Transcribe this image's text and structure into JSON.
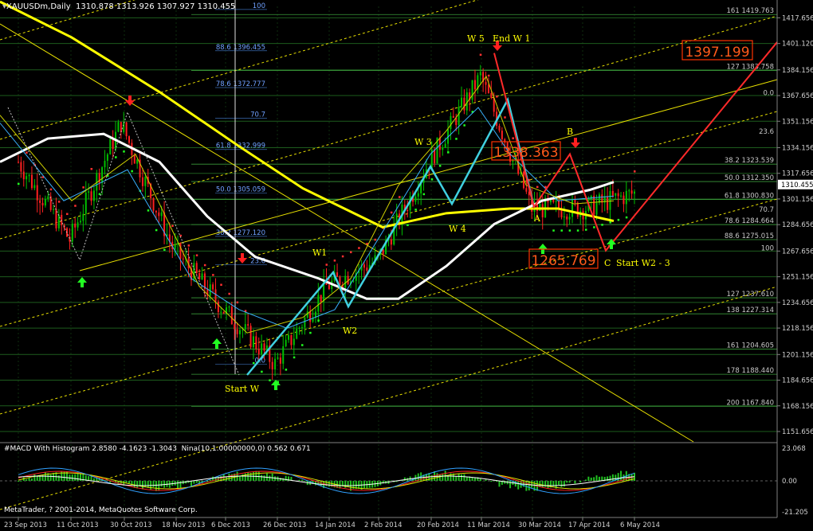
{
  "header": {
    "title": "XAUUSDm,Daily",
    "ohlc": "1310.878 1313.926 1307.927 1310.455",
    "indicator": "#MACD With Histogram 2.8580 -4.1623 -1.3043",
    "indicator2": "Nina(10,1.00000000,0) 0.562 0.671",
    "copyright": "MetaTrader, ? 2001-2014, MetaQuotes Software Corp."
  },
  "price_axis": {
    "ticks": [
      "1417.656",
      "1401.120",
      "1384.156",
      "1367.656",
      "1351.156",
      "1334.156",
      "1317.656",
      "1301.156",
      "1284.656",
      "1267.656",
      "1251.156",
      "1234.656",
      "1218.156",
      "1201.156",
      "1184.656",
      "1168.156",
      "1151.656"
    ],
    "current_price": "1310.455"
  },
  "macd_axis": {
    "ticks": [
      "23.068",
      "0.00",
      "-21.205"
    ]
  },
  "time_axis": {
    "ticks": [
      "23 Sep 2013",
      "11 Oct 2013",
      "30 Oct 2013",
      "18 Nov 2013",
      "6 Dec 2013",
      "26 Dec 2013",
      "14 Jan 2014",
      "2 Feb 2014",
      "20 Feb 2014",
      "11 Mar 2014",
      "30 Mar 2014",
      "17 Apr 2014",
      "6 May 2014"
    ]
  },
  "fib_left": [
    "100",
    "88.6  1396.455",
    "78.6  1372.777",
    "70.7",
    "61.8  1332.999",
    "50.0  1305.059",
    "38.2  1277.120",
    "23.6",
    "0.0"
  ],
  "fib_right": [
    "161  1419.763",
    "127  1383.758",
    "100",
    "0.0",
    "23.6",
    "38.2  1323.539",
    "50.0  1312.350",
    "61.8  1300.830",
    "70.7",
    "78.6  1284.664",
    "88.6  1275.015",
    "100",
    "127  1237.610",
    "138  1227.314",
    "161  1204.605",
    "178  1188.440",
    "200  1167.840"
  ],
  "waves": {
    "w5": "W 5",
    "endw1": "End W 1",
    "w3": "W 3",
    "w4": "W 4",
    "w1": "W1",
    "w2": "W2",
    "start_w": "Start W",
    "a": "A",
    "b": "B",
    "c": "C",
    "start_w2": "Start W2 - 3"
  },
  "boxes": {
    "target": "1397.199",
    "b_level": "1338.363",
    "c_level": "1265.769"
  },
  "chart_data": {
    "type": "candlestick",
    "title": "XAUUSDm,Daily",
    "ylim": [
      1145,
      1425
    ],
    "y_ticks": [
      1417.656,
      1401.12,
      1384.156,
      1367.656,
      1351.156,
      1334.156,
      1317.656,
      1301.156,
      1284.656,
      1267.656,
      1251.156,
      1234.656,
      1218.156,
      1201.156,
      1184.656,
      1168.156,
      1151.656
    ],
    "close_path": [
      [
        "23 Sep 2013",
        1325
      ],
      [
        "11 Oct 2013",
        1275
      ],
      [
        "30 Oct 2013",
        1350
      ],
      [
        "18 Nov 2013",
        1270
      ],
      [
        "6 Dec 2013",
        1230
      ],
      [
        "26 Dec 2013",
        1195
      ],
      [
        "14 Jan 2014",
        1245
      ],
      [
        "2 Feb 2014",
        1262
      ],
      [
        "20 Feb 2014",
        1325
      ],
      [
        "11 Mar 2014",
        1380
      ],
      [
        "30 Mar 2014",
        1295
      ],
      [
        "17 Apr 2014",
        1295
      ],
      [
        "6 May 2014",
        1305
      ]
    ],
    "last_ohlc": {
      "open": 1310.878,
      "high": 1313.926,
      "low": 1307.927,
      "close": 1310.455
    },
    "fib_levels": [
      {
        "label": "161",
        "value": 1419.763
      },
      {
        "label": "127",
        "value": 1383.758
      },
      {
        "label": "38.2",
        "value": 1323.539
      },
      {
        "label": "50.0",
        "value": 1312.35
      },
      {
        "label": "61.8",
        "value": 1300.83
      },
      {
        "label": "78.6",
        "value": 1284.664
      },
      {
        "label": "88.6",
        "value": 1275.015
      },
      {
        "label": "127",
        "value": 1237.61
      },
      {
        "label": "138",
        "value": 1227.314
      },
      {
        "label": "161",
        "value": 1204.605
      },
      {
        "label": "178",
        "value": 1188.44
      },
      {
        "label": "200",
        "value": 1167.84
      }
    ],
    "macd": {
      "main": 2.858,
      "signal": -4.1623,
      "histogram": -1.3043,
      "ylim": [
        -21.205,
        23.068
      ]
    }
  },
  "colors": {
    "background": "#000000",
    "grid": "#1d5c1d",
    "candle_up": "#00c000",
    "candle_down": "#ff2020",
    "ma_slow": "#ffff00",
    "ma_mid": "#ffffff",
    "wave": "#40d0e0",
    "box": "#ff3300"
  }
}
